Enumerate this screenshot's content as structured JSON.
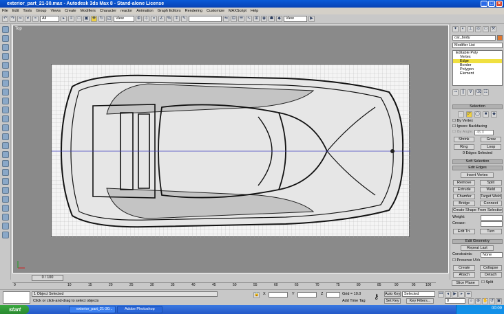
{
  "window": {
    "title": "exterior_part_21-30.max - Autodesk 3ds Max 8 - Stand-alone License"
  },
  "menu": [
    "File",
    "Edit",
    "Tools",
    "Group",
    "Views",
    "Create",
    "Modifiers",
    "Character",
    "reactor",
    "Animation",
    "Graph Editors",
    "Rendering",
    "Customize",
    "MAXScript",
    "Help"
  ],
  "toolbar": {
    "selection_filter": "All",
    "ref_coord": "View",
    "named_sel": "",
    "render_dd": "View"
  },
  "viewport": {
    "label": "Top"
  },
  "command_panel": {
    "object_name": "car_body",
    "modifier_list": "Modifier List",
    "stack": [
      "Editable Poly",
      "Vertex",
      "Edge",
      "Border",
      "Polygon",
      "Element"
    ],
    "stack_selected": "Edge",
    "selection_title": "Selection",
    "by_vertex": "By Vertex",
    "ignore_backfacing": "Ignore Backfacing",
    "by_angle": "By Angle:",
    "by_angle_value": "45.0",
    "shrink": "Shrink",
    "grow": "Grow",
    "ring": "Ring",
    "loop": "Loop",
    "edges_selected": "0 Edges Selected",
    "soft_selection": "Soft Selection",
    "edit_edges": "Edit Edges",
    "insert_vertex": "Insert Vertex",
    "remove": "Remove",
    "split": "Split",
    "extrude": "Extrude",
    "weld": "Weld",
    "chamfer": "Chamfer",
    "target_weld": "Target Weld",
    "bridge": "Bridge",
    "connect": "Connect",
    "create_shape": "Create Shape From Selection",
    "weight": "Weight:",
    "crease": "Crease:",
    "edit_tri": "Edit Tri.",
    "turn": "Turn",
    "edit_geometry": "Edit Geometry",
    "repeat_last": "Repeat Last",
    "constraints": "Constraints:",
    "constraints_value": "None",
    "preserve_uvs": "Preserve UVs",
    "create": "Create",
    "collapse": "Collapse",
    "attach": "Attach",
    "detach": "Detach",
    "slice_plane": "Slice Plane",
    "split2": "Split"
  },
  "time": {
    "slider": "0 / 100",
    "ticks": [
      "0",
      "10",
      "15",
      "20",
      "25",
      "30",
      "35",
      "40",
      "45",
      "50",
      "55",
      "60",
      "65",
      "70",
      "75",
      "80",
      "85",
      "90",
      "95",
      "100"
    ]
  },
  "status": {
    "object_selected": "1 Object Selected",
    "prompt": "Click or click-and-drag to select objects",
    "x_label": "X",
    "y_label": "Y",
    "z_label": "Z",
    "grid": "Grid = 10.0",
    "add_time_tag": "Add Time Tag",
    "auto_key": "Auto Key",
    "auto_key_value": "Selected",
    "set_key": "Set Key",
    "key_filters": "Key Filters...",
    "frame": "0"
  },
  "taskbar": {
    "start": "start",
    "tasks": [
      "exterior_part_21-30...",
      "Adobe Photoshop"
    ],
    "clock": "00:09"
  },
  "colors": {
    "title": "#0a5ad8",
    "selected": "#f0e040",
    "viewport_bg": "#8a8a8a"
  }
}
